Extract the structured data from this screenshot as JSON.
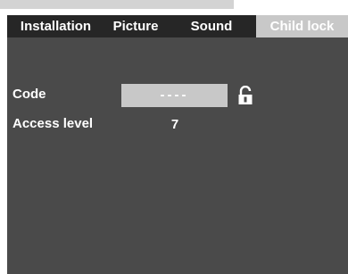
{
  "tabs": [
    {
      "label": "Installation",
      "active": false
    },
    {
      "label": "Picture",
      "active": false
    },
    {
      "label": "Sound",
      "active": false
    },
    {
      "label": "Child lock",
      "active": true
    }
  ],
  "rows": {
    "code_label": "Code",
    "code_value": "----",
    "access_label": "Access level",
    "access_value": "7"
  },
  "icons": {
    "lock": "unlocked-padlock-icon"
  },
  "colors": {
    "panel": "#4a4a4a",
    "tabbar": "#262626",
    "highlight": "#c8c8c8",
    "text": "#ffffff"
  }
}
